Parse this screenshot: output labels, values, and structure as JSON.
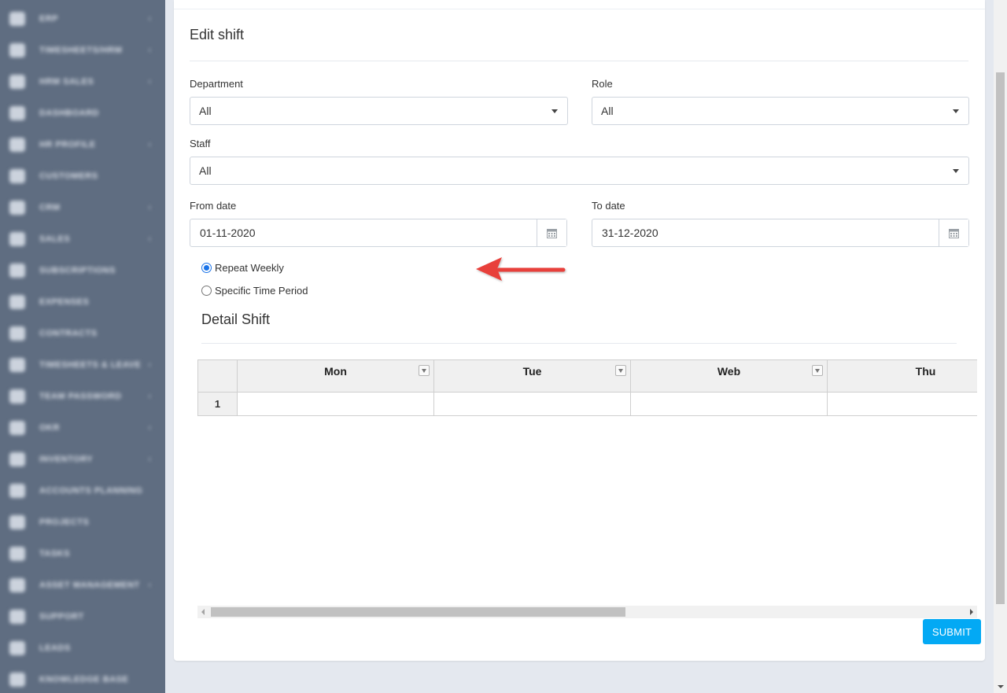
{
  "sidebar": {
    "items": [
      {
        "label": "ERP",
        "icon": "home-icon",
        "has_chevron": true
      },
      {
        "label": "TIMESHEETS/HRM",
        "icon": "edit-icon",
        "has_chevron": true
      },
      {
        "label": "HRM SALES",
        "icon": "briefcase-icon",
        "has_chevron": true
      },
      {
        "label": "DASHBOARD",
        "icon": "home-icon",
        "has_chevron": false
      },
      {
        "label": "HR PROFILE",
        "icon": "user-icon",
        "has_chevron": true
      },
      {
        "label": "CUSTOMERS",
        "icon": "customer-icon",
        "has_chevron": false
      },
      {
        "label": "CRM",
        "icon": "home-icon",
        "has_chevron": true
      },
      {
        "label": "SALES",
        "icon": "sales-icon",
        "has_chevron": true
      },
      {
        "label": "SUBSCRIPTIONS",
        "icon": "edit-icon",
        "has_chevron": false
      },
      {
        "label": "EXPENSES",
        "icon": "expense-icon",
        "has_chevron": false
      },
      {
        "label": "CONTRACTS",
        "icon": "document-icon",
        "has_chevron": false
      },
      {
        "label": "TIMESHEETS & LEAVE",
        "icon": "calendar-icon",
        "has_chevron": true
      },
      {
        "label": "TEAM PASSWORD",
        "icon": "key-icon",
        "has_chevron": true
      },
      {
        "label": "OKR",
        "icon": "target-icon",
        "has_chevron": true
      },
      {
        "label": "INVENTORY",
        "icon": "inventory-icon",
        "has_chevron": true
      },
      {
        "label": "ACCOUNTS PLANNING",
        "icon": "accounts-icon",
        "has_chevron": false
      },
      {
        "label": "PROJECTS",
        "icon": "projects-icon",
        "has_chevron": false
      },
      {
        "label": "TASKS",
        "icon": "tasks-icon",
        "has_chevron": false
      },
      {
        "label": "ASSET MANAGEMENT",
        "icon": "asset-icon",
        "has_chevron": true
      },
      {
        "label": "SUPPORT",
        "icon": "support-icon",
        "has_chevron": false
      },
      {
        "label": "LEADS",
        "icon": "leads-icon",
        "has_chevron": false
      },
      {
        "label": "KNOWLEDGE BASE",
        "icon": "knowledge-icon",
        "has_chevron": false
      }
    ]
  },
  "form": {
    "title": "Edit shift",
    "department": {
      "label": "Department",
      "value": "All"
    },
    "role": {
      "label": "Role",
      "value": "All"
    },
    "staff": {
      "label": "Staff",
      "value": "All"
    },
    "from_date": {
      "label": "From date",
      "value": "01-11-2020"
    },
    "to_date": {
      "label": "To date",
      "value": "31-12-2020"
    },
    "repeat_options": [
      {
        "label": "Repeat Weekly",
        "checked": true
      },
      {
        "label": "Specific Time Period",
        "checked": false
      }
    ],
    "detail_title": "Detail Shift",
    "grid": {
      "columns": [
        "Mon",
        "Tue",
        "Web",
        "Thu"
      ],
      "rows": [
        "1"
      ]
    },
    "submit_label": "SUBMIT"
  },
  "colors": {
    "sidebar_bg": "#5f6d81",
    "accent": "#03a9f4",
    "arrow": "#e8403b",
    "page_bg": "#e4e8ef"
  }
}
